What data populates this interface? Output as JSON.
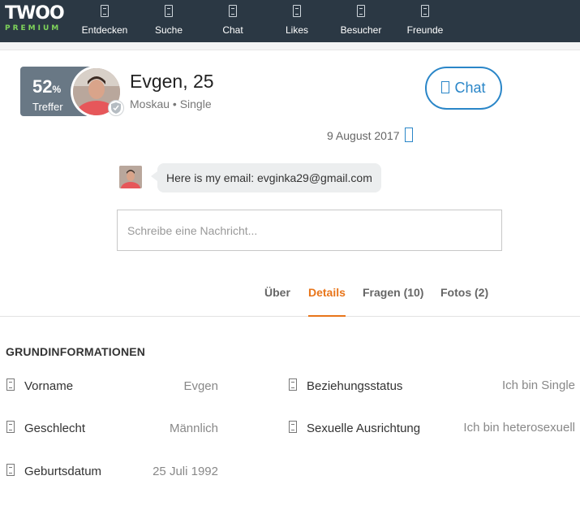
{
  "brand": {
    "logo": "TWOO",
    "tier": "PREMIUM"
  },
  "nav": [
    {
      "label": "Entdecken",
      "icon": "discover-icon"
    },
    {
      "label": "Suche",
      "icon": "search-icon"
    },
    {
      "label": "Chat",
      "icon": "chat-icon"
    },
    {
      "label": "Likes",
      "icon": "heart-icon"
    },
    {
      "label": "Besucher",
      "icon": "visitors-icon"
    },
    {
      "label": "Freunde",
      "icon": "friends-icon"
    }
  ],
  "profile": {
    "match_value": "52",
    "match_unit": "%",
    "match_label": "Treffer",
    "name_age": "Evgen, 25",
    "location_status": "Moskau • Single",
    "chat_button": "Chat"
  },
  "conversation": {
    "date": "9 August 2017",
    "message": "Here is my email: evginka29@gmail.com",
    "composer_placeholder": "Schreibe eine Nachricht..."
  },
  "tabs": [
    {
      "label": "Über",
      "active": false
    },
    {
      "label": "Details",
      "active": true
    },
    {
      "label": "Fragen (10)",
      "active": false
    },
    {
      "label": "Fotos (2)",
      "active": false
    }
  ],
  "details": {
    "title": "GRUNDINFORMATIONEN",
    "left": [
      {
        "label": "Vorname",
        "value": "Evgen"
      },
      {
        "label": "Geschlecht",
        "value": "Männlich"
      },
      {
        "label": "Geburtsdatum",
        "value": "25 Juli 1992"
      }
    ],
    "right": [
      {
        "label": "Beziehungsstatus",
        "value": "Ich bin Single"
      },
      {
        "label": "Sexuelle Ausrichtung",
        "value": "Ich bin heterosexuell"
      }
    ]
  },
  "colors": {
    "nav_bg": "#2b3844",
    "accent_orange": "#e8751a",
    "accent_blue": "#2a86c8",
    "match_badge": "#697885"
  }
}
